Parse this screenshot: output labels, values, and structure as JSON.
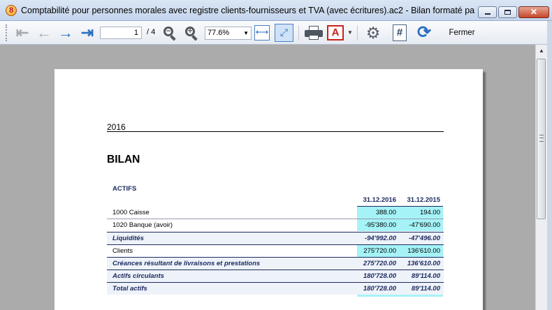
{
  "window": {
    "title": "Comptabilité pour personnes morales avec registre clients-fournisseurs et TVA (avec écritures).ac2 - Bilan formaté par gro...",
    "icon": "banana-app-icon"
  },
  "toolbar": {
    "page_current": "1",
    "page_total": "/ 4",
    "zoom": "77.6%",
    "close_label": "Fermer",
    "icons": [
      "first-page-icon",
      "previous-page-icon",
      "next-page-icon",
      "last-page-icon",
      "zoom-out-icon",
      "zoom-in-icon",
      "fit-width-icon",
      "fit-page-icon",
      "print-icon",
      "pdf-icon",
      "settings-gear-icon",
      "page-number-icon",
      "refresh-icon"
    ]
  },
  "report": {
    "year": "2016",
    "title": "BILAN",
    "section": "ACTIFS",
    "col1": "31.12.2016",
    "col2": "31.12.2015",
    "rows": [
      {
        "label": "1000   Caisse",
        "v1": "388.00",
        "v2": "194.00"
      },
      {
        "label": "1020   Banque (avoir)",
        "v1": "-95'380.00",
        "v2": "-47'690.00"
      },
      {
        "label": "Liquidités",
        "v1": "-94'992.00",
        "v2": "-47'496.00"
      },
      {
        "label": "Clients",
        "v1": "275'720.00",
        "v2": "136'610.00"
      },
      {
        "label": "Créances résultant de livraisons et prestations",
        "v1": "275'720.00",
        "v2": "136'610.00"
      },
      {
        "label": "Actifs circulants",
        "v1": "180'728.00",
        "v2": "89'114.00"
      },
      {
        "label": "Total actifs",
        "v1": "180'728.00",
        "v2": "89'114.00"
      }
    ]
  },
  "colors": {
    "cyan_highlight": "#a5f3f7",
    "subtotal_text": "#1b2b60",
    "accent_blue": "#2a6fc3",
    "pdf_red": "#c8231b"
  }
}
